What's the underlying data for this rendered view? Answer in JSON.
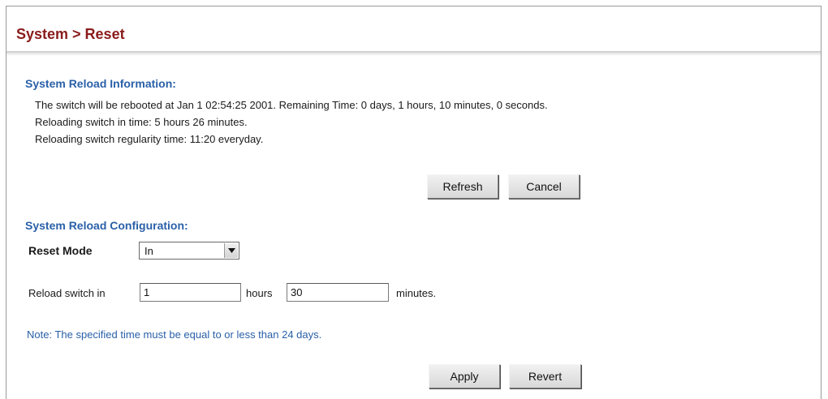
{
  "header": {
    "title": "System > Reset"
  },
  "reload_info": {
    "title": "System Reload Information:",
    "lines": [
      "The switch will be rebooted at Jan 1 02:54:25 2001. Remaining Time: 0 days, 1 hours, 10 minutes, 0 seconds.",
      "Reloading switch in time: 5 hours 26 minutes.",
      "Reloading switch regularity time: 11:20 everyday."
    ],
    "refresh_label": "Refresh",
    "cancel_label": "Cancel"
  },
  "reload_config": {
    "title": "System Reload Configuration:",
    "reset_mode_label": "Reset Mode",
    "reset_mode_value": "In",
    "reload_in_label": "Reload switch in",
    "hours_value": "1",
    "hours_label": "hours",
    "minutes_value": "30",
    "minutes_label": "minutes.",
    "note": "Note: The specified time must be equal to or less than 24 days.",
    "apply_label": "Apply",
    "revert_label": "Revert"
  },
  "colors": {
    "title": "#8a1c1c",
    "section": "#2a60a8"
  }
}
